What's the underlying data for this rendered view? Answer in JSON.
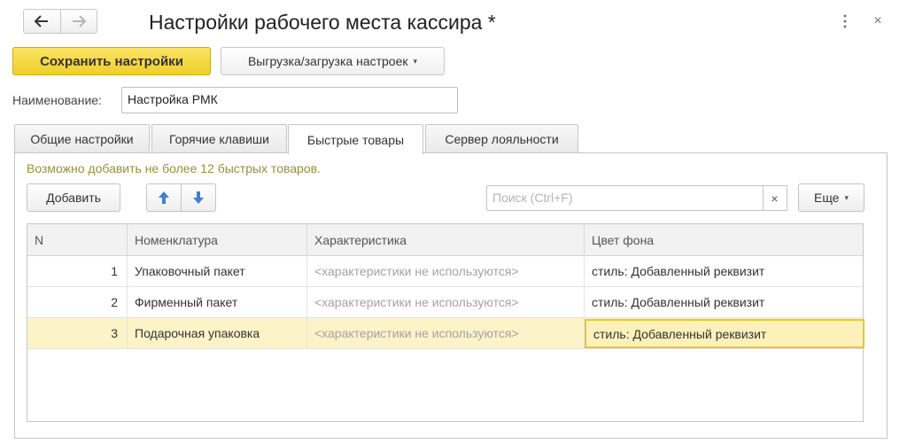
{
  "window": {
    "title": "Настройки рабочего места кассира *",
    "more_icon": "more-vertical-icon",
    "close_label": "×"
  },
  "nav": {
    "back_icon": "arrow-left-icon",
    "forward_icon": "arrow-right-icon"
  },
  "toolbar": {
    "save_label": "Сохранить настройки",
    "export_label": "Выгрузка/загрузка настроек",
    "export_caret": "▾"
  },
  "name_field": {
    "label": "Наименование:",
    "value": "Настройка РМК"
  },
  "tabs": [
    {
      "label": "Общие настройки",
      "active": false
    },
    {
      "label": "Горячие клавиши",
      "active": false
    },
    {
      "label": "Быстрые товары",
      "active": true
    },
    {
      "label": "Сервер лояльности",
      "active": false
    }
  ],
  "panel": {
    "hint": "Возможно добавить не более 12 быстрых товаров.",
    "add_label": "Добавить",
    "up_icon": "arrow-up-icon",
    "down_icon": "arrow-down-icon",
    "search_placeholder": "Поиск (Ctrl+F)",
    "search_clear": "×",
    "more_label": "Еще",
    "more_caret": "▾"
  },
  "table": {
    "columns": [
      "N",
      "Номенклатура",
      "Характеристика",
      "Цвет фона"
    ],
    "rows": [
      {
        "n": "1",
        "item": "Упаковочный пакет",
        "characteristic": "<характеристики не используются>",
        "color": "стиль: Добавленный реквизит"
      },
      {
        "n": "2",
        "item": "Фирменный пакет",
        "characteristic": "<характеристики не используются>",
        "color": "стиль: Добавленный реквизит"
      },
      {
        "n": "3",
        "item": "Подарочная упаковка",
        "characteristic": "<характеристики не используются>",
        "color": "стиль: Добавленный реквизит"
      }
    ],
    "selected_row": 2
  },
  "colors": {
    "accent_yellow": "#efcf2a",
    "selection": "#fdf3c8",
    "arrow_blue": "#3f7fcf",
    "hint_text": "#9a8e3c"
  }
}
